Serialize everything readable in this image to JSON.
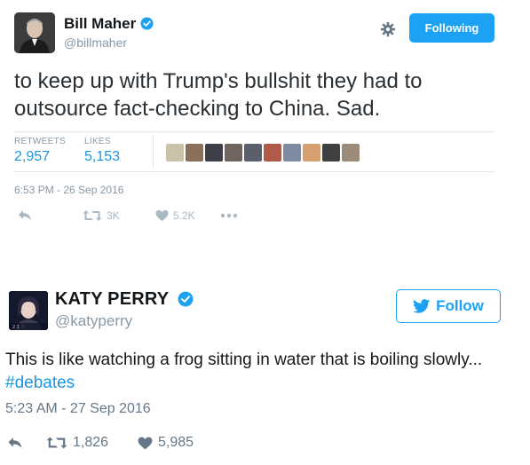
{
  "tweet1": {
    "name": "Bill Maher",
    "handle": "@billmaher",
    "follow_label": "Following",
    "text": "to keep up with Trump's bullshit they had to outsource fact-checking to China. Sad.",
    "retweets_label": "RETWEETS",
    "retweets_value": "2,957",
    "likes_label": "LIKES",
    "likes_value": "5,153",
    "timestamp": "6:53 PM - 26 Sep 2016",
    "actions": {
      "retweet_count": "3K",
      "like_count": "5.2K"
    },
    "icons": [
      "verified-icon",
      "gear-icon",
      "reply-icon",
      "retweet-icon",
      "heart-icon",
      "more-icon"
    ]
  },
  "tweet2": {
    "name": "KATY PERRY",
    "handle": "@katyperry",
    "follow_label": "Follow",
    "text_main": "This is like watching a frog sitting in water that is boiling slowly... ",
    "hashtag": "#debates",
    "timestamp": "5:23 AM - 27 Sep 2016",
    "actions": {
      "retweet_count": "1,826",
      "like_count": "5,985"
    },
    "icons": [
      "verified-icon",
      "twitter-bird-icon",
      "reply-icon",
      "retweet-icon",
      "heart-icon"
    ]
  },
  "colors": {
    "twitter_blue": "#1da1f2",
    "link_blue": "#1b95e0",
    "muted_gray": "#8899a6"
  }
}
